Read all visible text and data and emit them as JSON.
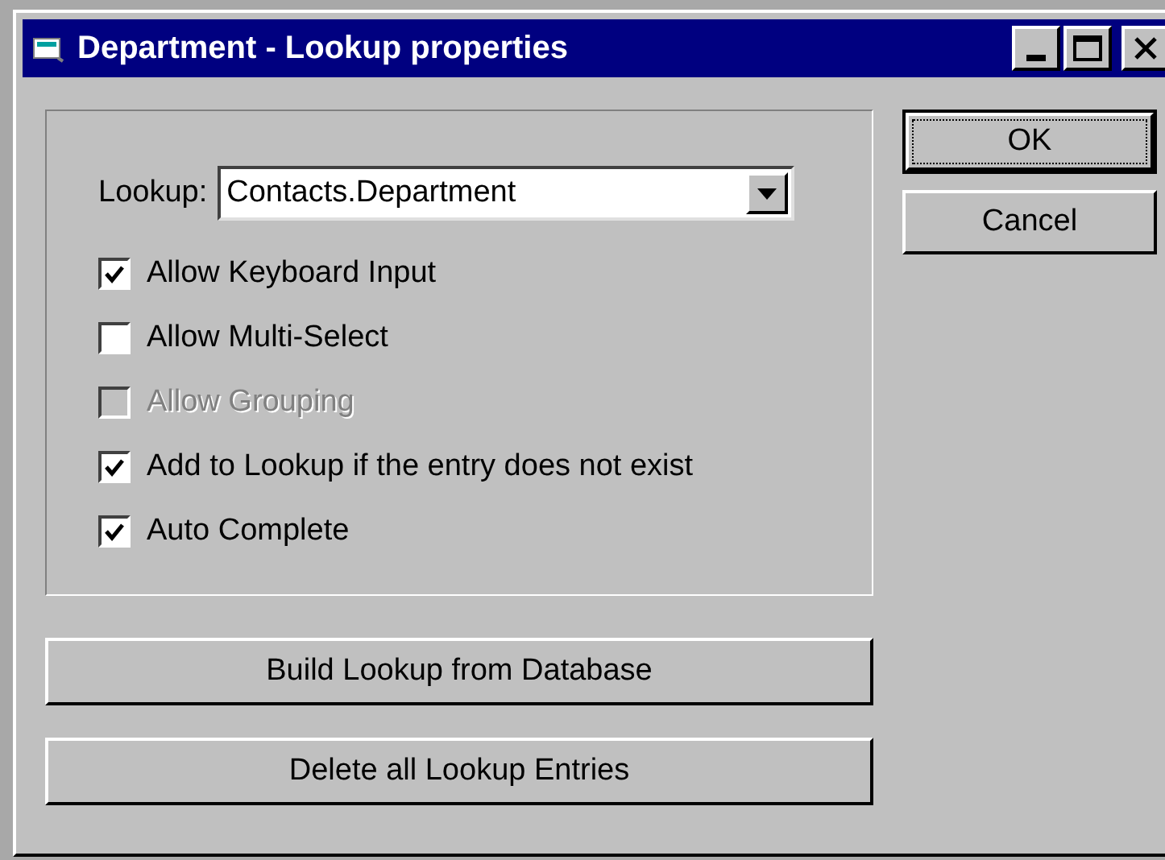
{
  "window": {
    "title": "Department - Lookup properties"
  },
  "lookup": {
    "label": "Lookup:",
    "value": "Contacts.Department"
  },
  "options": [
    {
      "label": "Allow Keyboard Input",
      "checked": true,
      "disabled": false
    },
    {
      "label": "Allow Multi-Select",
      "checked": false,
      "disabled": false
    },
    {
      "label": "Allow Grouping",
      "checked": false,
      "disabled": true
    },
    {
      "label": "Add to Lookup if the entry does not exist",
      "checked": true,
      "disabled": false
    },
    {
      "label": "Auto Complete",
      "checked": true,
      "disabled": false
    }
  ],
  "side_buttons": [
    {
      "label": "OK",
      "focused": true
    },
    {
      "label": "Cancel",
      "focused": false
    }
  ],
  "actions": [
    "Build Lookup from Database",
    "Delete all Lookup Entries"
  ]
}
